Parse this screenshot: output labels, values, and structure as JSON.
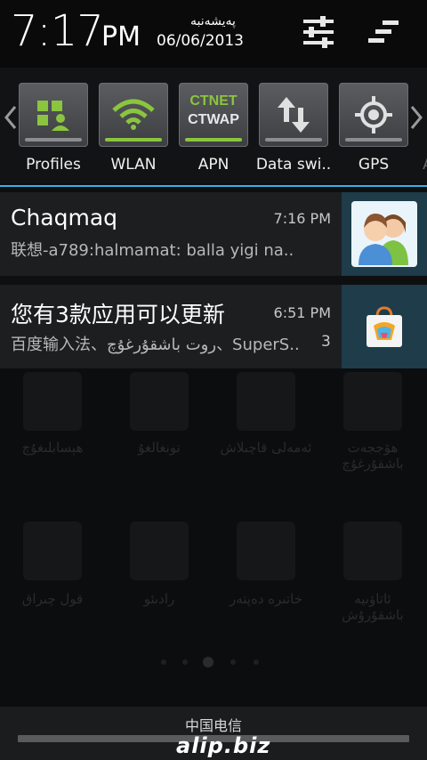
{
  "header": {
    "time": "7:17",
    "ampm": "PM",
    "day_name": "پەيشەنبە",
    "date": "06/06/2013"
  },
  "toggles": {
    "items": [
      {
        "label": "Profiles",
        "icon": "profiles-icon",
        "active": false
      },
      {
        "label": "WLAN",
        "icon": "wifi-icon",
        "active": true
      },
      {
        "label": "APN",
        "icon": "apn-icon",
        "active": true,
        "line1": "CTNET",
        "line2": "CTWAP"
      },
      {
        "label": "Data swi..",
        "icon": "data-switch-icon",
        "active": false
      },
      {
        "label": "GPS",
        "icon": "gps-icon",
        "active": false
      }
    ],
    "partial_label": "A"
  },
  "notifications": [
    {
      "title": "Chaqmaq",
      "time": "7:16 PM",
      "text": "联想-a789:halmamat: balla  yigi na..",
      "icon": "contacts-avatar-icon"
    },
    {
      "title": "您有3款应用可以更新",
      "time": "6:51 PM",
      "text": "百度输入法、روت باشقۇرغۇچ、SuperS..",
      "count": "3",
      "icon": "app-store-bag-icon"
    }
  ],
  "background_home": {
    "labels_row1": [
      "ھېسابلىغۇچ",
      "تونغالغۇ",
      "ئەمەلى قاچىلاش",
      "ھۆججەت باشقۇرغۇچ"
    ],
    "labels_row2": [
      "قول چىراق",
      "رادىئو",
      "خاتىرە دەپتەر",
      "ئاتاۋىيە باشقۇرۇش"
    ]
  },
  "footer": {
    "carrier": "中国电信",
    "watermark": "alip.biz"
  },
  "colors": {
    "accent": "#33b5e5",
    "toggle_on": "#8bc53f",
    "notif_bg": "#1d1e20",
    "icon_box_bg": "#1e3c49"
  }
}
